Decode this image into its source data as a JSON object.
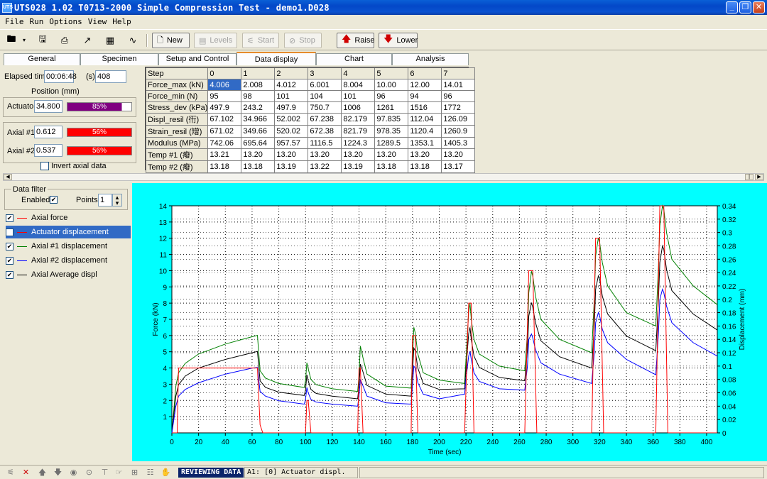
{
  "window": {
    "title": "UTS028 1.02 T0713-2000 Simple Compression Test - demo1.D028",
    "icon_text": "UTS"
  },
  "menu": [
    "File",
    "Run",
    "Options",
    "View",
    "Help"
  ],
  "toolbar": {
    "new_label": "New",
    "levels_label": "Levels",
    "start_label": "Start",
    "stop_label": "Stop",
    "raise_label": "Raise",
    "lower_label": "Lower"
  },
  "tabs": [
    "General",
    "Specimen",
    "Setup and Control",
    "Data display",
    "Chart",
    "Analysis"
  ],
  "active_tab": "Data display",
  "left_panel": {
    "elapsed_label": "Elapsed time",
    "elapsed_value": "00:06:48",
    "seconds_label": "(s)",
    "seconds_value": "408",
    "position_label": "Position (mm)",
    "actuator_label": "Actuator",
    "actuator_value": "34.800",
    "actuator_bar": {
      "percent": 85,
      "text": "85%",
      "color": "#800080"
    },
    "axial1_label": "Axial #1",
    "axial1_value": "0.612",
    "axial1_bar": {
      "percent": 100,
      "text": "56%",
      "color": "#ff0000"
    },
    "axial2_label": "Axial #2",
    "axial2_value": "0.537",
    "axial2_bar": {
      "percent": 100,
      "text": "56%",
      "color": "#ff0000"
    },
    "invert_label": "Invert axial data"
  },
  "table": {
    "header": [
      "Step",
      "0",
      "1",
      "2",
      "3",
      "4",
      "5",
      "6",
      "7"
    ],
    "rows": [
      [
        "Force_max (kN)",
        "4.006",
        "2.008",
        "4.012",
        "6.001",
        "8.004",
        "10.00",
        "12.00",
        "14.01"
      ],
      [
        "Force_min (N)",
        "95",
        "98",
        "101",
        "104",
        "101",
        "96",
        "94",
        "96"
      ],
      [
        "Stress_dev (kPa)",
        "497.9",
        "243.2",
        "497.9",
        "750.7",
        "1006",
        "1261",
        "1516",
        "1772"
      ],
      [
        "Displ_resil (衎)",
        "67.102",
        "34.966",
        "52.002",
        "67.238",
        "82.179",
        "97.835",
        "112.04",
        "126.09"
      ],
      [
        "Strain_resil (矰)",
        "671.02",
        "349.66",
        "520.02",
        "672.38",
        "821.79",
        "978.35",
        "1120.4",
        "1260.9"
      ],
      [
        "Modulus (MPa)",
        "742.06",
        "695.64",
        "957.57",
        "1116.5",
        "1224.3",
        "1289.5",
        "1353.1",
        "1405.3"
      ],
      [
        "Temp #1 (癈)",
        "13.21",
        "13.20",
        "13.20",
        "13.20",
        "13.20",
        "13.20",
        "13.20",
        "13.20"
      ],
      [
        "Temp #2 (癈)",
        "13.18",
        "13.18",
        "13.19",
        "13.22",
        "13.19",
        "13.18",
        "13.18",
        "13.17"
      ]
    ],
    "selected_cell": [
      0,
      1
    ]
  },
  "filter": {
    "title": "Data filter",
    "enabled_label": "Enabled",
    "enabled": true,
    "points_label": "Points",
    "points_value": "1"
  },
  "series_list": [
    {
      "name": "Axial force",
      "checked": true,
      "color": "#ff0000",
      "selected": false
    },
    {
      "name": "Actuator displacement",
      "checked": false,
      "color": "#ff0000",
      "selected": true
    },
    {
      "name": "Axial #1 displacement",
      "checked": true,
      "color": "#008000",
      "selected": false
    },
    {
      "name": "Axial #2 displacement",
      "checked": true,
      "color": "#0000ff",
      "selected": false
    },
    {
      "name": "Axial Average displ",
      "checked": true,
      "color": "#000000",
      "selected": false
    }
  ],
  "status": {
    "mode": "REVIEWING DATA",
    "message": "A1: [0] Actuator displ."
  },
  "chart_data": {
    "type": "line",
    "xlabel": "Time (sec)",
    "ylabel": "Force (kN)",
    "y2label": "Displacement (mm)",
    "xlim": [
      0,
      408
    ],
    "ylim": [
      0,
      14
    ],
    "y2lim": [
      0,
      0.34
    ],
    "xticks": [
      0,
      20,
      40,
      60,
      80,
      100,
      120,
      140,
      160,
      180,
      200,
      220,
      240,
      260,
      280,
      300,
      320,
      340,
      360,
      380,
      400
    ],
    "yticks": [
      1,
      2,
      3,
      4,
      5,
      6,
      7,
      8,
      9,
      10,
      11,
      12,
      13,
      14
    ],
    "y2ticks": [
      0,
      0.02,
      0.04,
      0.06,
      0.08,
      0.1,
      0.12,
      0.14,
      0.16,
      0.18,
      0.2,
      0.22,
      0.24,
      0.26,
      0.28,
      0.3,
      0.32,
      0.34
    ],
    "y2tick_labels": [
      "0",
      "0.02",
      "0.04",
      "0.06",
      "0.08",
      "0.1",
      "0.12",
      "0.14",
      "0.16",
      "0.18",
      "0.2",
      "0.22",
      "0.24",
      "0.26",
      "0.28",
      "0.3",
      "0.32",
      "0.34"
    ],
    "grid": true,
    "background": "#ffffff",
    "plot_frame_color": "#00ffff",
    "series": [
      {
        "name": "Axial force",
        "axis": "y",
        "color": "#ff0000",
        "x": [
          0,
          4,
          5,
          60,
          64,
          66,
          68,
          100,
          101,
          102,
          104,
          139,
          140,
          141,
          143,
          179,
          180,
          182,
          184,
          219,
          222,
          224,
          226,
          264,
          267,
          270,
          273,
          314,
          317,
          320,
          323,
          362,
          365,
          368,
          371,
          408
        ],
        "y": [
          0,
          0,
          4,
          4,
          4,
          0.5,
          0,
          0,
          2,
          2,
          0,
          0,
          4,
          4,
          0,
          0,
          6,
          6,
          0,
          0,
          8,
          8,
          0,
          0,
          10,
          10,
          0,
          0,
          12,
          12,
          0,
          0,
          14,
          14,
          0,
          0
        ]
      },
      {
        "name": "Axial #1 displacement",
        "axis": "y2",
        "color": "#008000",
        "x": [
          0,
          3,
          5,
          10,
          20,
          40,
          60,
          64,
          66,
          70,
          80,
          99,
          100,
          101,
          102,
          104,
          108,
          120,
          139,
          140,
          141,
          143,
          146,
          160,
          179,
          180,
          181,
          182,
          184,
          188,
          200,
          219,
          220,
          222,
          223,
          224,
          226,
          230,
          245,
          264,
          266,
          267,
          269,
          270,
          272,
          276,
          290,
          314,
          316,
          317,
          319,
          320,
          322,
          326,
          340,
          362,
          364,
          365,
          367,
          368,
          370,
          374,
          390,
          408
        ],
        "y": [
          0,
          0.07,
          0.09,
          0.104,
          0.118,
          0.133,
          0.144,
          0.146,
          0.093,
          0.082,
          0.074,
          0.068,
          0.078,
          0.105,
          0.096,
          0.08,
          0.072,
          0.066,
          0.062,
          0.085,
          0.13,
          0.112,
          0.088,
          0.07,
          0.067,
          0.11,
          0.158,
          0.15,
          0.118,
          0.09,
          0.079,
          0.074,
          0.11,
          0.18,
          0.194,
          0.17,
          0.14,
          0.118,
          0.1,
          0.093,
          0.15,
          0.21,
          0.242,
          0.235,
          0.205,
          0.17,
          0.14,
          0.12,
          0.2,
          0.265,
          0.292,
          0.285,
          0.255,
          0.22,
          0.18,
          0.16,
          0.25,
          0.31,
          0.34,
          0.335,
          0.3,
          0.26,
          0.22,
          0.192
        ]
      },
      {
        "name": "Axial #2 displacement",
        "axis": "y2",
        "color": "#0000ff",
        "x": [
          0,
          3,
          5,
          10,
          20,
          40,
          60,
          64,
          66,
          70,
          80,
          99,
          100,
          101,
          102,
          104,
          108,
          120,
          139,
          140,
          141,
          143,
          146,
          160,
          179,
          180,
          181,
          182,
          184,
          188,
          200,
          219,
          220,
          222,
          223,
          224,
          226,
          230,
          245,
          264,
          266,
          267,
          269,
          270,
          272,
          276,
          290,
          314,
          316,
          317,
          319,
          320,
          322,
          326,
          340,
          362,
          364,
          365,
          367,
          368,
          370,
          374,
          390,
          408
        ],
        "y": [
          0,
          0.04,
          0.055,
          0.065,
          0.075,
          0.088,
          0.097,
          0.098,
          0.062,
          0.055,
          0.048,
          0.043,
          0.05,
          0.068,
          0.06,
          0.05,
          0.046,
          0.043,
          0.04,
          0.055,
          0.08,
          0.07,
          0.055,
          0.045,
          0.043,
          0.07,
          0.1,
          0.097,
          0.075,
          0.058,
          0.051,
          0.058,
          0.08,
          0.115,
          0.122,
          0.11,
          0.09,
          0.077,
          0.066,
          0.064,
          0.1,
          0.14,
          0.148,
          0.142,
          0.125,
          0.105,
          0.088,
          0.074,
          0.12,
          0.165,
          0.18,
          0.175,
          0.155,
          0.135,
          0.11,
          0.087,
          0.15,
          0.2,
          0.215,
          0.21,
          0.19,
          0.165,
          0.135,
          0.115
        ]
      },
      {
        "name": "Axial Average displ",
        "axis": "y2",
        "color": "#000000",
        "x": [
          0,
          3,
          5,
          10,
          20,
          40,
          60,
          64,
          66,
          70,
          80,
          99,
          100,
          101,
          102,
          104,
          108,
          120,
          139,
          140,
          141,
          143,
          146,
          160,
          179,
          180,
          181,
          182,
          184,
          188,
          200,
          219,
          220,
          222,
          223,
          224,
          226,
          230,
          245,
          264,
          266,
          267,
          269,
          270,
          272,
          276,
          290,
          314,
          316,
          317,
          319,
          320,
          322,
          326,
          340,
          362,
          364,
          365,
          367,
          368,
          370,
          374,
          390,
          408
        ],
        "y": [
          0,
          0.055,
          0.072,
          0.085,
          0.097,
          0.11,
          0.12,
          0.122,
          0.078,
          0.068,
          0.061,
          0.056,
          0.064,
          0.087,
          0.078,
          0.065,
          0.059,
          0.055,
          0.051,
          0.07,
          0.103,
          0.091,
          0.071,
          0.058,
          0.055,
          0.09,
          0.127,
          0.123,
          0.097,
          0.074,
          0.065,
          0.066,
          0.095,
          0.148,
          0.158,
          0.14,
          0.115,
          0.098,
          0.083,
          0.078,
          0.125,
          0.175,
          0.195,
          0.188,
          0.165,
          0.138,
          0.114,
          0.097,
          0.16,
          0.215,
          0.235,
          0.23,
          0.205,
          0.178,
          0.145,
          0.123,
          0.2,
          0.255,
          0.28,
          0.275,
          0.245,
          0.213,
          0.178,
          0.154
        ]
      }
    ]
  }
}
